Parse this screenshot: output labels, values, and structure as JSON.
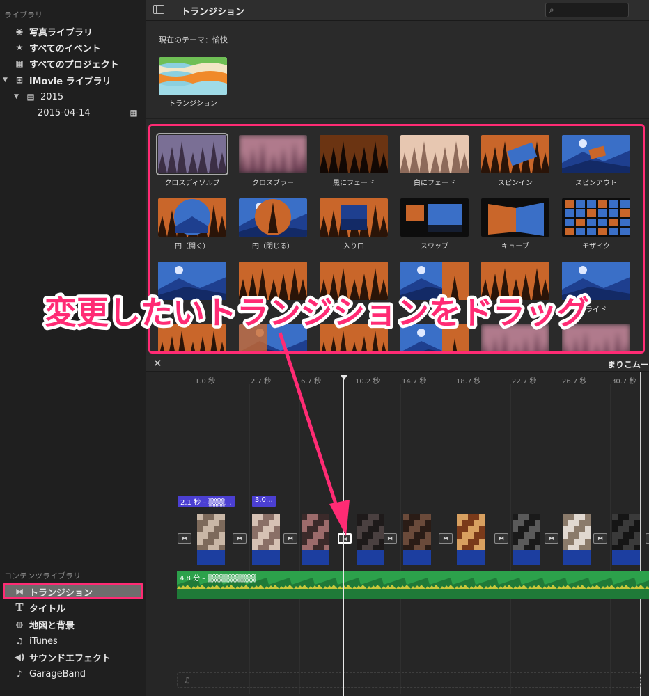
{
  "sidebar": {
    "library_header": "ライブラリ",
    "library_items": [
      {
        "label": "写真ライブラリ",
        "icon": "photo-library-icon"
      },
      {
        "label": "すべてのイベント",
        "icon": "star-icon"
      },
      {
        "label": "すべてのプロジェクト",
        "icon": "clapper-icon"
      },
      {
        "label": "iMovie ライブラリ",
        "icon": "grid-icon"
      },
      {
        "label": "2015",
        "icon": "film-icon"
      },
      {
        "label": "2015-04-14",
        "icon": "clapper-icon"
      }
    ],
    "content_header": "コンテンツライブラリ",
    "content_items": [
      {
        "label": "トランジション",
        "icon": "transition-icon",
        "selected": true
      },
      {
        "label": "タイトル",
        "icon": "title-t-icon"
      },
      {
        "label": "地図と背景",
        "icon": "globe-icon"
      },
      {
        "label": "iTunes",
        "icon": "music-note-icon"
      },
      {
        "label": "サウンドエフェクト",
        "icon": "speaker-icon"
      },
      {
        "label": "GarageBand",
        "icon": "guitar-icon"
      }
    ]
  },
  "browser": {
    "title": "トランジション",
    "search_placeholder": "",
    "theme_label": "現在のテーマ：愉快",
    "theme_caption": "トランジション",
    "transitions": [
      "クロスディゾルブ",
      "クロスブラー",
      "黒にフェード",
      "白にフェード",
      "スピンイン",
      "スピンアウト",
      "円（開く）",
      "円（閉じる）",
      "入り口",
      "スワップ",
      "キューブ",
      "モザイク",
      "",
      "",
      "",
      "",
      "",
      "ライド",
      "",
      "",
      "",
      "",
      "",
      ""
    ]
  },
  "callout": "変更したいトランジションをドラッグ",
  "timeline": {
    "project_title": "まりこムー",
    "ticks": [
      "1.0 秒",
      "2.7 秒",
      "6.7 秒",
      "10.2 秒",
      "14.7 秒",
      "18.7 秒",
      "22.7 秒",
      "26.7 秒",
      "30.7 秒"
    ],
    "clip_labels": [
      "2.1 秒 – ▒▒▒…",
      "3.0…"
    ],
    "audio_label": "4.8 分 – ▒▒▒▒▒▒▒▒▒"
  },
  "colors": {
    "highlight": "#ff2b74",
    "audio": "#2ca14b",
    "clip_blue": "#1c3ea0",
    "label_purple": "#4b3fd2"
  }
}
